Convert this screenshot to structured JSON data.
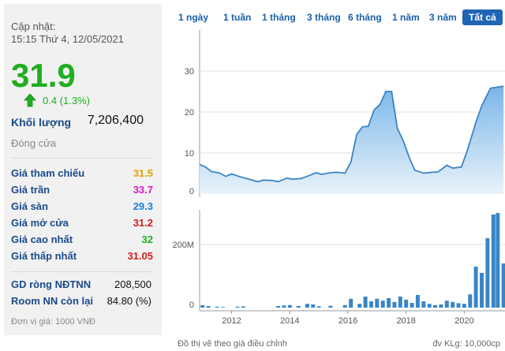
{
  "panel": {
    "update_label": "Cập nhật:",
    "update_time": "15:15 Thứ 4, 12/05/2021",
    "price": "31.9",
    "change": "0.4 (1.3%)",
    "volume_label": "Khối lượng",
    "volume_value": "7,206,400",
    "close_label": "Đóng cửa",
    "rows": [
      {
        "label": "Giá tham chiếu",
        "value": "31.5",
        "color": "#e8a300"
      },
      {
        "label": "Giá trần",
        "value": "33.7",
        "color": "#d81bc8"
      },
      {
        "label": "Giá sàn",
        "value": "29.3",
        "color": "#1a7fd6"
      },
      {
        "label": "Giá mở cửa",
        "value": "31.2",
        "color": "#d51b1b"
      },
      {
        "label": "Giá cao nhất",
        "value": "32",
        "color": "#1fae1f"
      },
      {
        "label": "Giá thấp nhất",
        "value": "31.05",
        "color": "#d51b1b"
      }
    ],
    "gd_label": "GD ròng NĐTNN",
    "gd_value": "208,500",
    "room_label": "Room NN còn lại",
    "room_value": "84.80 (%)",
    "unit": "Đơn vị giá: 1000 VNĐ"
  },
  "tabs": [
    {
      "label": "1 ngày",
      "active": false
    },
    {
      "label": "1 tuần",
      "active": false
    },
    {
      "label": "1 tháng",
      "active": false
    },
    {
      "label": "3 tháng",
      "active": false
    },
    {
      "label": "6 tháng",
      "active": false
    },
    {
      "label": "1 năm",
      "active": false
    },
    {
      "label": "3 năm",
      "active": false
    },
    {
      "label": "Tất cả",
      "active": true
    }
  ],
  "footer": {
    "left": "Đồ thị vẽ theo giá điều chỉnh",
    "right": "đv KLg: 10,000cp"
  },
  "colors": {
    "price_up": "#1fae1f",
    "label_blue": "#1a4a8a",
    "line": "#3a85c5"
  },
  "chart_data": [
    {
      "type": "area",
      "x_ticks": [
        "2012",
        "2014",
        "2016",
        "2018",
        "2020"
      ],
      "y_ticks": [
        "0",
        "10",
        "20",
        "30"
      ],
      "ylim": [
        0,
        30
      ],
      "xlim": [
        2010.9,
        2021.4
      ],
      "x": [
        2010.9,
        2011.1,
        2011.3,
        2011.6,
        2011.8,
        2012.0,
        2012.3,
        2012.6,
        2012.9,
        2013.1,
        2013.4,
        2013.6,
        2013.9,
        2014.1,
        2014.4,
        2014.7,
        2014.9,
        2015.1,
        2015.4,
        2015.6,
        2015.9,
        2016.1,
        2016.3,
        2016.5,
        2016.7,
        2016.9,
        2017.1,
        2017.3,
        2017.5,
        2017.7,
        2017.9,
        2018.1,
        2018.3,
        2018.6,
        2018.9,
        2019.1,
        2019.4,
        2019.6,
        2019.9,
        2020.1,
        2020.4,
        2020.6,
        2020.9,
        2021.1,
        2021.35
      ],
      "values": [
        7.2,
        6.6,
        5.5,
        5.1,
        4.3,
        4.9,
        4.2,
        3.6,
        3.0,
        3.4,
        3.3,
        3.0,
        3.9,
        3.6,
        3.8,
        4.6,
        5.2,
        4.8,
        5.2,
        5.3,
        5.1,
        7.8,
        14.5,
        16.4,
        16.5,
        20.5,
        21.8,
        25.0,
        25.0,
        16.0,
        13.0,
        9.0,
        5.8,
        5.1,
        5.3,
        5.4,
        7.0,
        6.3,
        6.6,
        10.5,
        17.5,
        21.5,
        25.8,
        26.0,
        26.3
      ]
    },
    {
      "type": "bar",
      "y_ticks": [
        "0",
        "200M"
      ],
      "ylim": [
        0,
        300
      ],
      "x": [
        2011.0,
        2011.2,
        2011.5,
        2011.7,
        2012.2,
        2012.4,
        2013.6,
        2013.8,
        2014.0,
        2014.3,
        2014.6,
        2014.8,
        2015.0,
        2015.4,
        2015.9,
        2016.1,
        2016.4,
        2016.6,
        2016.8,
        2017.0,
        2017.2,
        2017.4,
        2017.6,
        2017.8,
        2018.0,
        2018.2,
        2018.4,
        2018.6,
        2018.8,
        2019.0,
        2019.2,
        2019.4,
        2019.6,
        2019.8,
        2020.0,
        2020.2,
        2020.4,
        2020.6,
        2020.8,
        2021.0,
        2021.15,
        2021.35
      ],
      "values": [
        8,
        5,
        3,
        2,
        3,
        4,
        5,
        7,
        8,
        5,
        12,
        10,
        4,
        6,
        8,
        28,
        12,
        35,
        20,
        28,
        22,
        30,
        18,
        35,
        25,
        15,
        40,
        20,
        12,
        8,
        10,
        22,
        18,
        14,
        12,
        42,
        130,
        110,
        220,
        295,
        300,
        140
      ]
    }
  ]
}
